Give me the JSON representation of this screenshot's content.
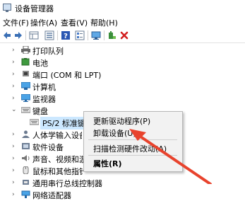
{
  "window": {
    "title": "设备管理器"
  },
  "menu": [
    {
      "label": "文件(F)"
    },
    {
      "label": "操作(A)"
    },
    {
      "label": "查看(V)"
    },
    {
      "label": "帮助(H)"
    }
  ],
  "tree": [
    {
      "label": "打印队列",
      "icon": "printer-icon",
      "state": "collapsed"
    },
    {
      "label": "电池",
      "icon": "battery-icon",
      "state": "collapsed"
    },
    {
      "label": "端口 (COM 和 LPT)",
      "icon": "port-icon",
      "state": "collapsed"
    },
    {
      "label": "计算机",
      "icon": "computer-icon",
      "state": "collapsed"
    },
    {
      "label": "监视器",
      "icon": "monitor-icon",
      "state": "collapsed"
    },
    {
      "label": "键盘",
      "icon": "keyboard-icon",
      "state": "expanded"
    },
    {
      "label": "PS/2 标准键盘",
      "icon": "keyboard-icon",
      "state": "child-selected"
    },
    {
      "label": "人体学输入设备",
      "icon": "hid-icon",
      "state": "collapsed"
    },
    {
      "label": "软件设备",
      "icon": "software-device-icon",
      "state": "collapsed"
    },
    {
      "label": "声音、视频和游戏控制器",
      "icon": "speaker-icon",
      "state": "collapsed"
    },
    {
      "label": "鼠标和其他指针设备",
      "icon": "mouse-icon",
      "state": "collapsed"
    },
    {
      "label": "通用串行总线控制器",
      "icon": "usb-icon",
      "state": "collapsed"
    },
    {
      "label": "网络适配器",
      "icon": "network-icon",
      "state": "collapsed"
    }
  ],
  "context_menu": {
    "items": [
      {
        "label": "更新驱动程序(P)"
      },
      {
        "label": "卸载设备(U)"
      },
      {
        "label": "扫描检测硬件改动(A)"
      },
      {
        "label": "属性(R)"
      }
    ]
  },
  "colors": {
    "selection": "#cce8ff",
    "arrow": "#e8432d",
    "uninstall_x": "#d21f1f"
  }
}
